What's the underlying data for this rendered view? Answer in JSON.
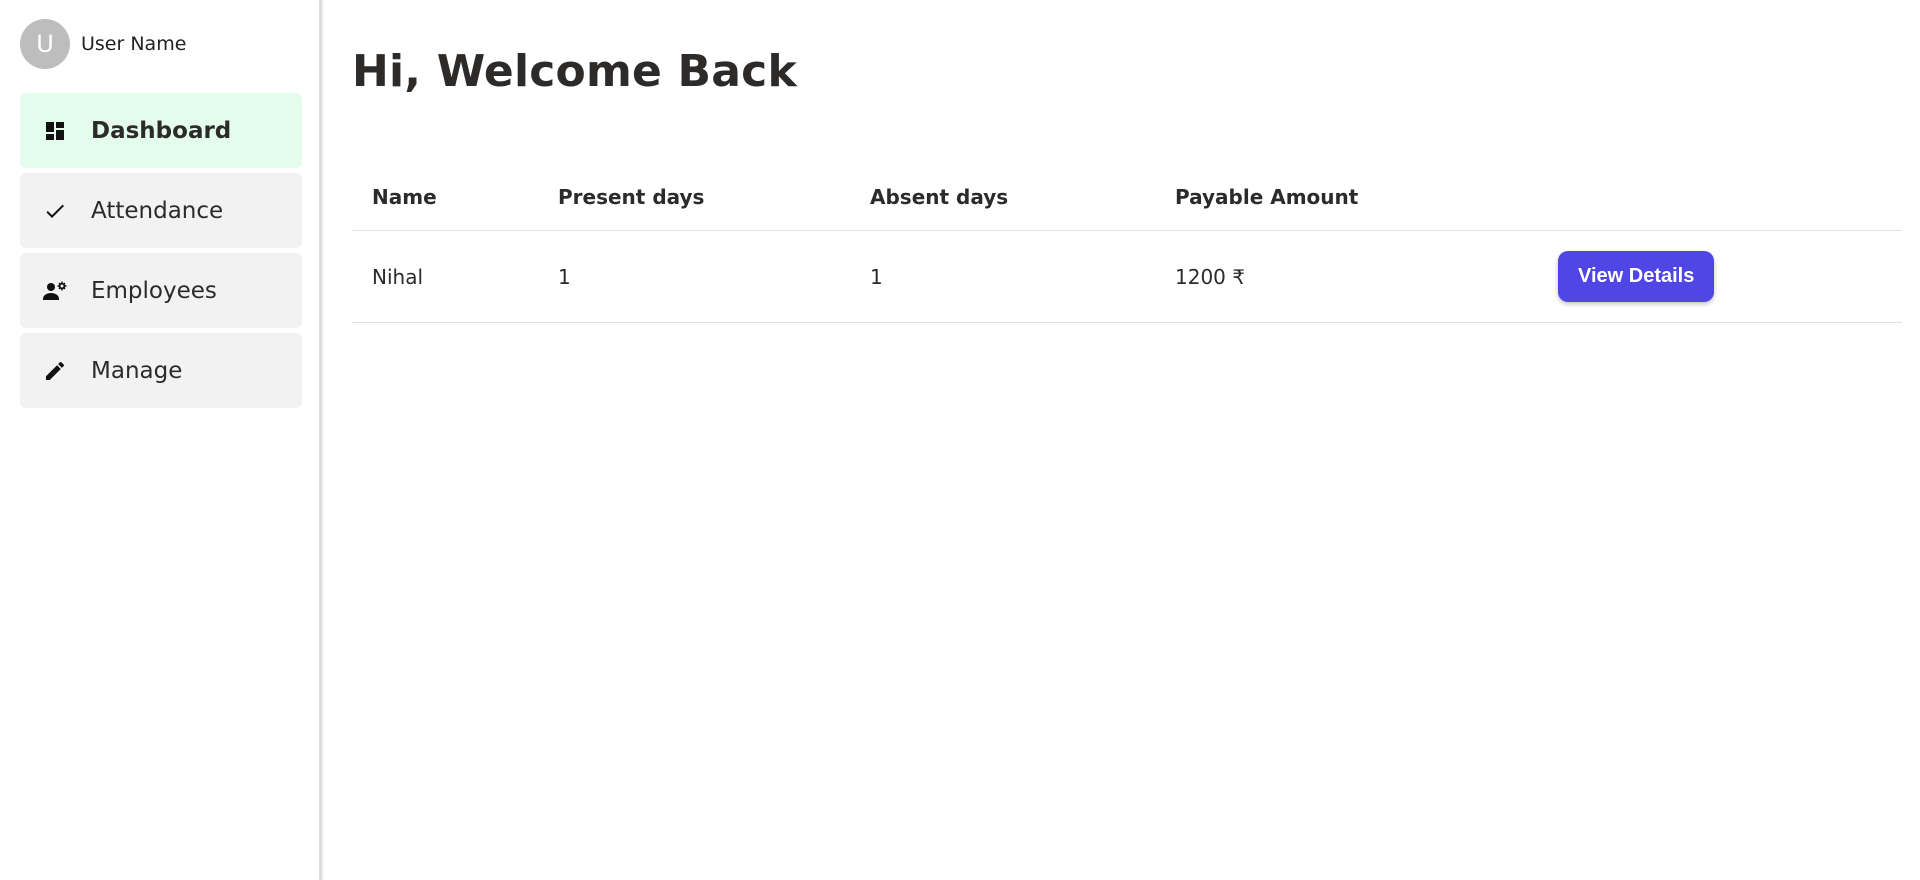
{
  "user": {
    "avatar_initial": "U",
    "name": "User Name"
  },
  "sidebar": {
    "items": [
      {
        "label": "Dashboard",
        "icon": "dashboard-icon",
        "active": true
      },
      {
        "label": "Attendance",
        "icon": "check-icon",
        "active": false
      },
      {
        "label": "Employees",
        "icon": "employees-icon",
        "active": false
      },
      {
        "label": "Manage",
        "icon": "pencil-icon",
        "active": false
      }
    ]
  },
  "main": {
    "greeting": "Hi, Welcome Back",
    "table": {
      "headers": [
        "Name",
        "Present days",
        "Absent days",
        "Payable Amount"
      ],
      "rows": [
        {
          "name": "Nihal",
          "present_days": "1",
          "absent_days": "1",
          "payable_amount": "1200 ₹",
          "action_label": "View Details"
        }
      ]
    }
  },
  "colors": {
    "active_nav_bg": "#e3fcec",
    "nav_bg": "#f2f2f2",
    "primary_button": "#4f46e5",
    "avatar_bg": "#bdbdbd"
  }
}
